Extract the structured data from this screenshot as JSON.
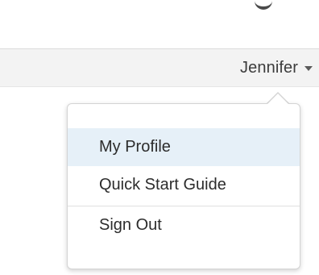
{
  "header": {
    "user_name": "Jennifer"
  },
  "user_menu": {
    "items": [
      {
        "label": "My Profile",
        "highlighted": true
      },
      {
        "label": "Quick Start Guide",
        "highlighted": false
      }
    ],
    "sign_out_label": "Sign Out"
  },
  "colors": {
    "header_bg": "#f3f3f3",
    "highlight_bg": "#e6f0f8",
    "text": "#2c2c2c"
  },
  "icons": {
    "caret": "chevron-down-icon"
  }
}
